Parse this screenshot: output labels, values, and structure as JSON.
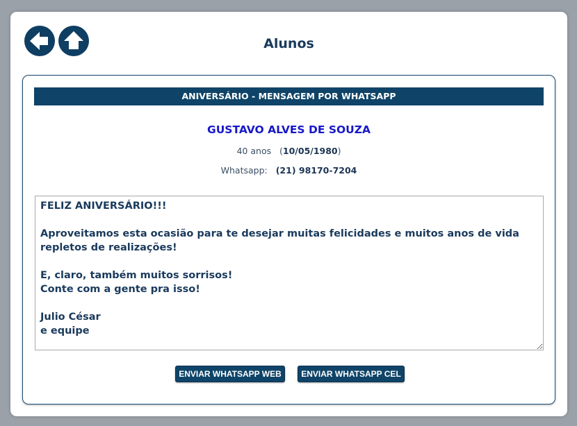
{
  "header": {
    "title": "Alunos",
    "back_icon": "arrow-left-icon",
    "up_icon": "arrow-up-icon"
  },
  "card": {
    "title": "ANIVERSÁRIO - MENSAGEM POR WHATSAPP",
    "student": {
      "name": "GUSTAVO ALVES DE SOUZA",
      "age": "40 anos",
      "birthdate": "10/05/1980",
      "whatsapp_label": "Whatsapp:",
      "whatsapp_number": "(21) 98170-7204"
    },
    "message": "FELIZ ANIVERSÁRIO!!!\n\nAproveitamos esta ocasião para te desejar muitas felicidades e muitos anos de vida repletos de realizações!\n\nE, claro, também muitos sorrisos!\nConte com a gente pra isso!\n\nJulio César\ne equipe",
    "buttons": {
      "web": "ENVIAR WHATSAPP WEB",
      "cel": "ENVIAR WHATSAPP CEL"
    }
  },
  "colors": {
    "primary": "#0f4468",
    "name": "#1717c9",
    "text": "#1a3a5c"
  }
}
